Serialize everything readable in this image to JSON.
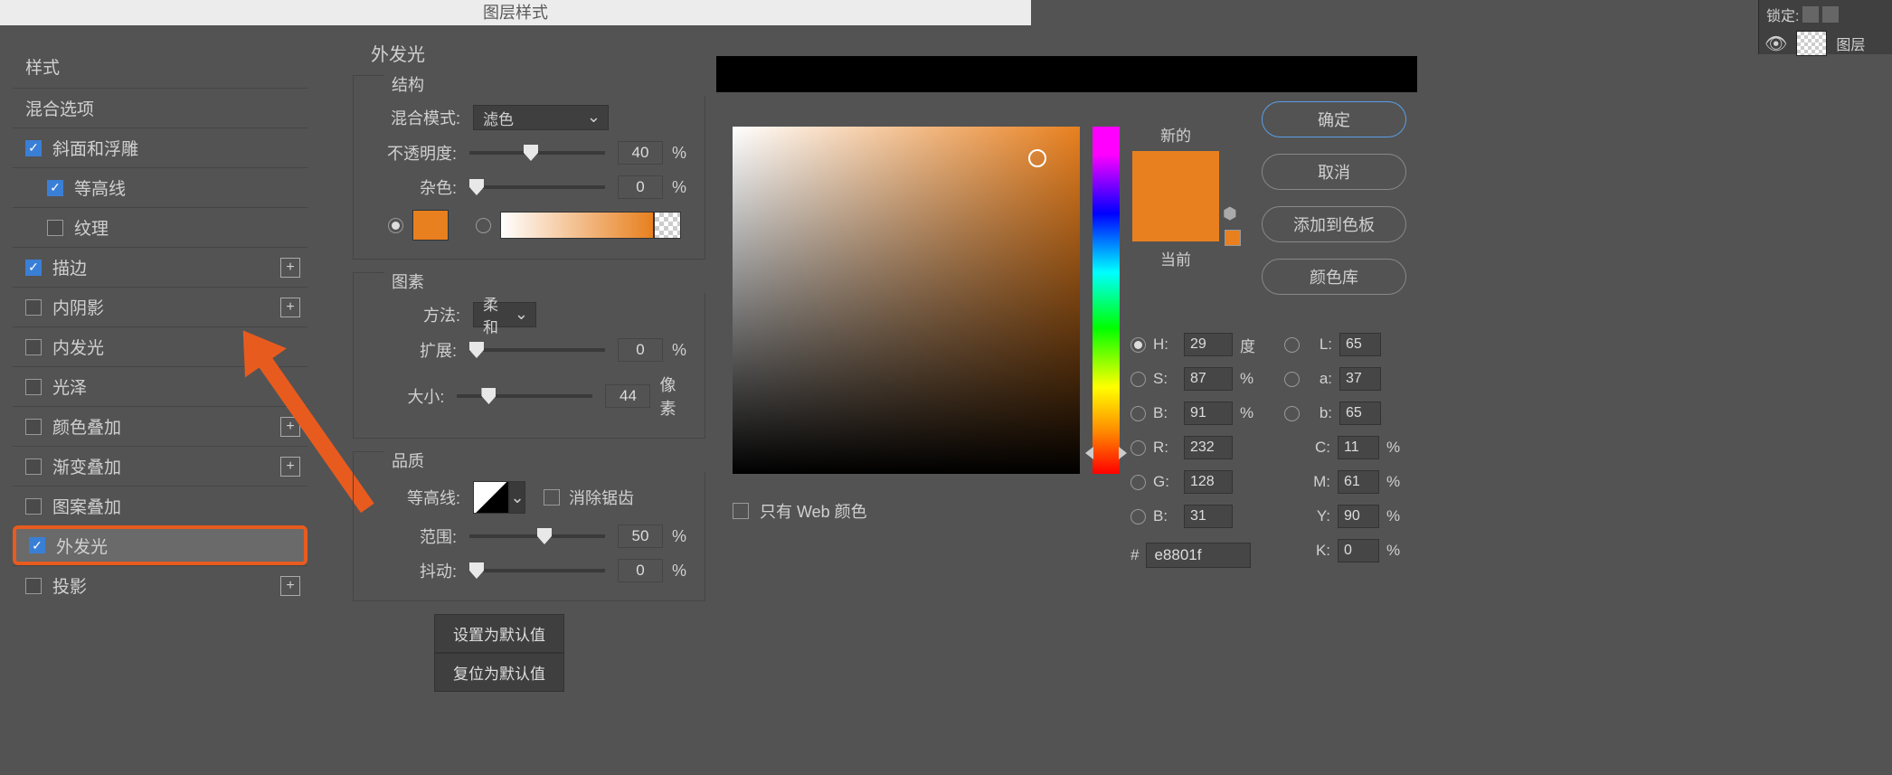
{
  "dialog_title": "图层样式",
  "styles_panel": {
    "header": "样式",
    "blend_options": "混合选项",
    "items": [
      {
        "label": "斜面和浮雕",
        "checked": true,
        "plus": false,
        "indent": false
      },
      {
        "label": "等高线",
        "checked": true,
        "plus": false,
        "indent": true
      },
      {
        "label": "纹理",
        "checked": false,
        "plus": false,
        "indent": true
      },
      {
        "label": "描边",
        "checked": true,
        "plus": true,
        "indent": false
      },
      {
        "label": "内阴影",
        "checked": false,
        "plus": true,
        "indent": false
      },
      {
        "label": "内发光",
        "checked": false,
        "plus": false,
        "indent": false
      },
      {
        "label": "光泽",
        "checked": false,
        "plus": false,
        "indent": false
      },
      {
        "label": "颜色叠加",
        "checked": false,
        "plus": true,
        "indent": false
      },
      {
        "label": "渐变叠加",
        "checked": false,
        "plus": true,
        "indent": false
      },
      {
        "label": "图案叠加",
        "checked": false,
        "plus": false,
        "indent": false
      },
      {
        "label": "外发光",
        "checked": true,
        "plus": false,
        "indent": false,
        "selected": true
      },
      {
        "label": "投影",
        "checked": false,
        "plus": true,
        "indent": false
      }
    ]
  },
  "outer_glow": {
    "title": "外发光",
    "structure": {
      "legend": "结构",
      "blend_mode_label": "混合模式:",
      "blend_mode_value": "滤色",
      "opacity_label": "不透明度:",
      "opacity_value": "40",
      "opacity_unit": "%",
      "noise_label": "杂色:",
      "noise_value": "0",
      "noise_unit": "%"
    },
    "elements": {
      "legend": "图素",
      "method_label": "方法:",
      "method_value": "柔和",
      "spread_label": "扩展:",
      "spread_value": "0",
      "spread_unit": "%",
      "size_label": "大小:",
      "size_value": "44",
      "size_unit": "像素"
    },
    "quality": {
      "legend": "品质",
      "contour_label": "等高线:",
      "antialias_label": "消除锯齿",
      "range_label": "范围:",
      "range_value": "50",
      "range_unit": "%",
      "jitter_label": "抖动:",
      "jitter_value": "0",
      "jitter_unit": "%"
    },
    "set_default": "设置为默认值",
    "reset_default": "复位为默认值"
  },
  "color_picker": {
    "new_label": "新的",
    "current_label": "当前",
    "ok": "确定",
    "cancel": "取消",
    "add_swatch": "添加到色板",
    "color_lib": "颜色库",
    "web_only": "只有 Web 颜色",
    "hsv": {
      "h": {
        "l": "H:",
        "v": "29",
        "u": "度"
      },
      "s": {
        "l": "S:",
        "v": "87",
        "u": "%"
      },
      "b": {
        "l": "B:",
        "v": "91",
        "u": "%"
      }
    },
    "rgb": {
      "r": {
        "l": "R:",
        "v": "232"
      },
      "g": {
        "l": "G:",
        "v": "128"
      },
      "b": {
        "l": "B:",
        "v": "31"
      }
    },
    "lab": {
      "l": {
        "l": "L:",
        "v": "65"
      },
      "a": {
        "l": "a:",
        "v": "37"
      },
      "b": {
        "l": "b:",
        "v": "65"
      }
    },
    "cmyk": {
      "c": {
        "l": "C:",
        "v": "11",
        "u": "%"
      },
      "m": {
        "l": "M:",
        "v": "61",
        "u": "%"
      },
      "y": {
        "l": "Y:",
        "v": "90",
        "u": "%"
      },
      "k": {
        "l": "K:",
        "v": "0",
        "u": "%"
      }
    },
    "hex_prefix": "#",
    "hex": "e8801f"
  },
  "layers_strip": {
    "lock_label": "锁定:",
    "layer_label": "图层"
  }
}
